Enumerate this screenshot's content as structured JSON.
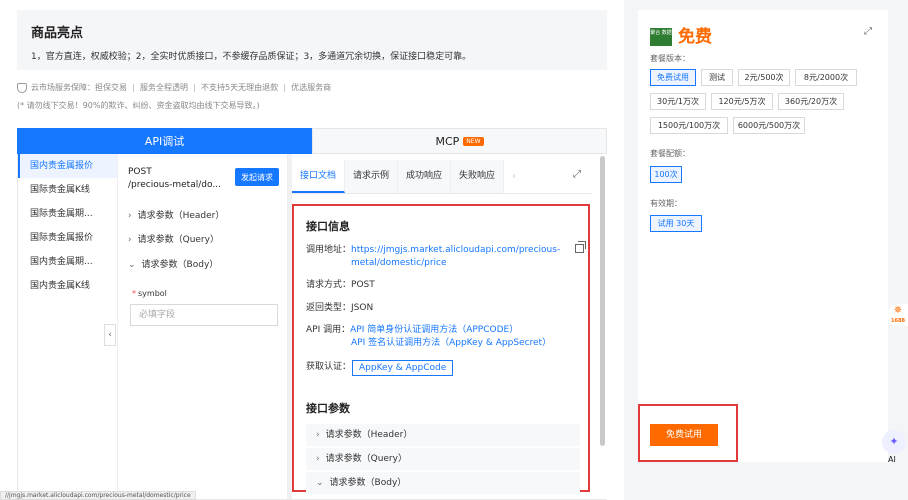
{
  "highlights": {
    "title": "商品亮点",
    "text": "1，官方直连，权威校验；2，全实时优质接口，不参缓存品质保证；3，多通道冗余切换，保证接口稳定可靠。"
  },
  "guarantee": {
    "label": "云市场服务保障：",
    "items": [
      "担保交易",
      "服务全程透明",
      "不支持5天无理由退款",
      "优选服务商"
    ],
    "warning": "(* 请勿线下交易！90%的欺诈、纠纷、资金盗取均由线下交易导致。)"
  },
  "tabs": {
    "api": "API调试",
    "mcp": "MCP",
    "new_badge": "NEW"
  },
  "api_list": [
    "国内贵金属报价",
    "国际贵金属K线",
    "国际贵金属期...",
    "国际贵金属报价",
    "国内贵金属期...",
    "国内贵金属K线"
  ],
  "params": {
    "method": "POST",
    "path": "/precious-metal/do...",
    "send_label": "发起请求",
    "header": "请求参数（Header）",
    "query": "请求参数（Query）",
    "body": "请求参数（Body）",
    "symbol_label": "symbol",
    "symbol_placeholder": "必填字段"
  },
  "doc": {
    "tabs": [
      "接口文档",
      "请求示例",
      "成功响应",
      "失败响应"
    ],
    "info_title": "接口信息",
    "url_label": "调用地址：",
    "url_line1": "https://jmgjs.market.alicloudapi.com/precious-",
    "url_line2": "metal/domestic/price",
    "method_label": "请求方式：",
    "method_value": "POST",
    "return_label": "返回类型：",
    "return_value": "JSON",
    "api_label": "API 调用：",
    "api_link1": "API 简单身份认证调用方法（APPCODE）",
    "api_link2": "API 签名认证调用方法（AppKey & AppSecret）",
    "auth_label": "获取认证：",
    "auth_button": "AppKey & AppCode",
    "params_title": "接口参数",
    "req_header": "请求参数（Header）",
    "req_query": "请求参数（Query）",
    "req_body": "请求参数（Body）"
  },
  "card": {
    "logo_text": "聚合 数据",
    "title": "免费",
    "version_label": "套餐版本：",
    "versions": [
      "免费试用",
      "测试",
      "2元/500次",
      "8元/2000次",
      "30元/1万次",
      "120元/5万次",
      "360元/20万次",
      "1500元/100万次",
      "6000元/500万次"
    ],
    "quota_label": "套餐配额：",
    "quota": "100次",
    "validity_label": "有效期：",
    "validity": "试用 30天",
    "try_button": "免费试用"
  },
  "side": {
    "badge": "1688",
    "ai": "AI"
  },
  "status_url": "//jmgjs.market.alicloudapi.com/precious-metal/domestic/price"
}
